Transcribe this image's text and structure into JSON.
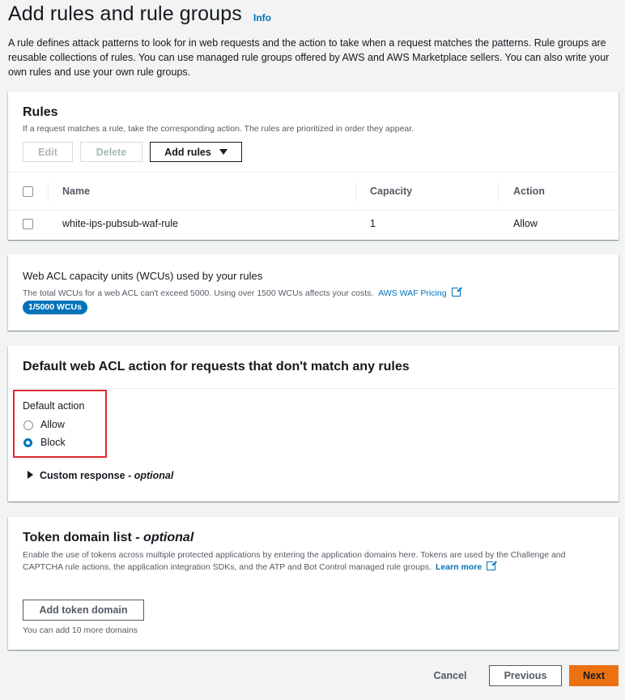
{
  "header": {
    "title": "Add rules and rule groups",
    "info_link": "Info",
    "intro": "A rule defines attack patterns to look for in web requests and the action to take when a request matches the patterns. Rule groups are reusable collections of rules. You can use managed rule groups offered by AWS and AWS Marketplace sellers. You can also write your own rules and use your own rule groups."
  },
  "rules": {
    "title": "Rules",
    "description": "If a request matches a rule, take the corresponding action. The rules are prioritized in order they appear.",
    "edit_label": "Edit",
    "delete_label": "Delete",
    "add_rules_label": "Add rules",
    "columns": {
      "name": "Name",
      "capacity": "Capacity",
      "action": "Action"
    },
    "rows": [
      {
        "name": "white-ips-pubsub-waf-rule",
        "capacity": "1",
        "action": "Allow"
      }
    ]
  },
  "wcu": {
    "title": "Web ACL capacity units (WCUs) used by your rules",
    "description": "The total WCUs for a web ACL can't exceed 5000. Using over 1500 WCUs affects your costs.",
    "pricing_link": "AWS WAF Pricing",
    "badge": "1/5000 WCUs"
  },
  "default_action": {
    "title": "Default web ACL action for requests that don't match any rules",
    "label": "Default action",
    "options": [
      {
        "label": "Allow",
        "selected": false
      },
      {
        "label": "Block",
        "selected": true
      }
    ],
    "custom_response_label": "Custom response",
    "custom_response_optional": " - optional"
  },
  "token": {
    "title": "Token domain list",
    "title_optional": " - optional",
    "description": "Enable the use of tokens across multiple protected applications by entering the application domains here. Tokens are used by the Challenge and CAPTCHA rule actions, the application integration SDKs, and the ATP and Bot Control managed rule groups.",
    "learn_more": "Learn more",
    "add_button": "Add token domain",
    "hint": "You can add 10 more domains"
  },
  "footer": {
    "cancel": "Cancel",
    "previous": "Previous",
    "next": "Next"
  },
  "colors": {
    "accent": "#0073bb",
    "primary_button": "#ec7211",
    "highlight": "#e02b31"
  }
}
